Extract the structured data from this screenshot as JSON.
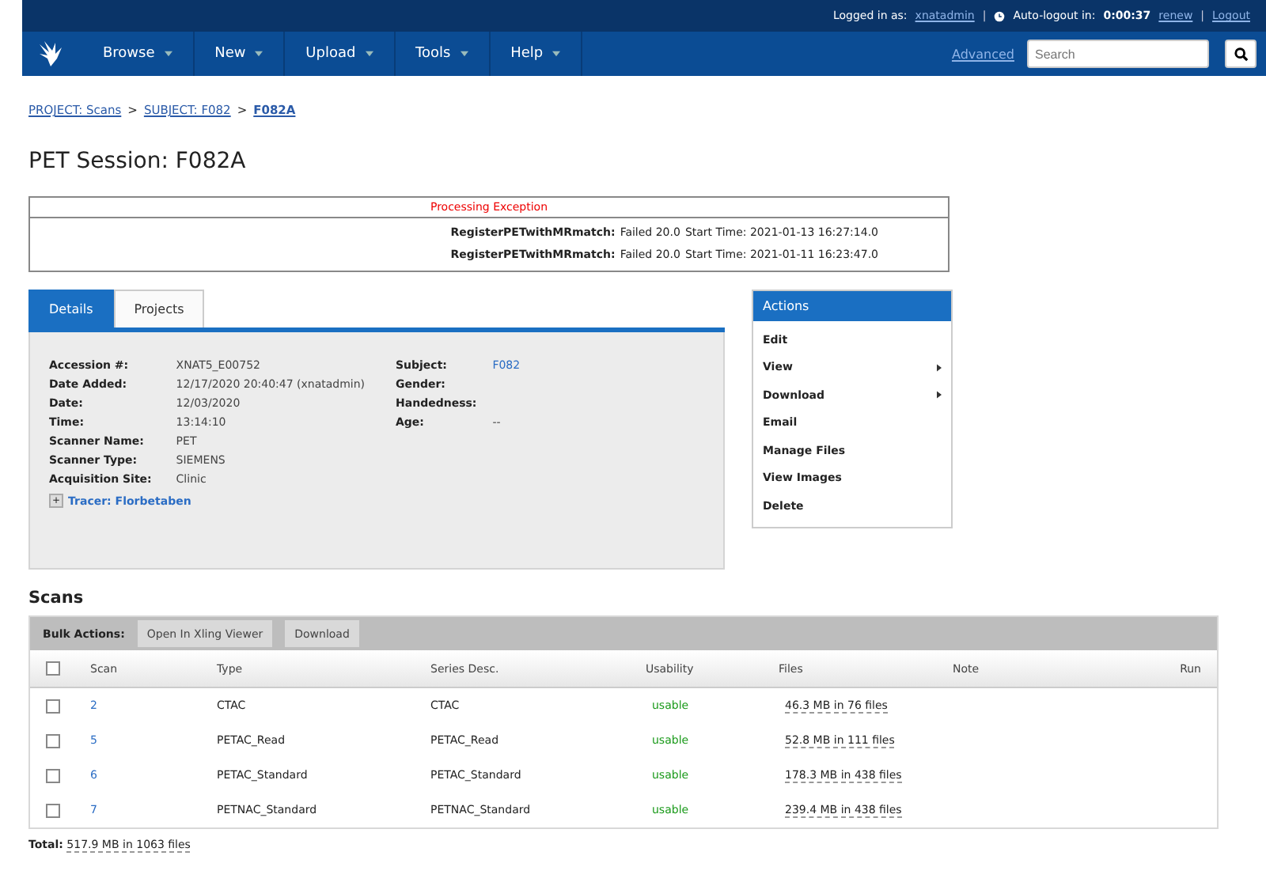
{
  "top_bar": {
    "logged_in_label": "Logged in as:",
    "username": "xnatadmin",
    "auto_logout_label": "Auto-logout in:",
    "timer": "0:00:37",
    "renew": "renew",
    "logout": "Logout",
    "separators": [
      "|",
      "|"
    ]
  },
  "nav": {
    "menus": [
      "Browse",
      "New",
      "Upload",
      "Tools",
      "Help"
    ],
    "advanced": "Advanced",
    "search": {
      "placeholder": "Search"
    }
  },
  "breadcrumb": [
    {
      "label": "PROJECT: Scans"
    },
    {
      "label": "SUBJECT: F082",
      "separator": ">"
    },
    {
      "label": "F082A",
      "separator": ">"
    }
  ],
  "title": "PET Session: F082A",
  "exceptions": {
    "title": "Processing Exception",
    "rows": [
      {
        "pipeline": "RegisterPETwithMRmatch:",
        "status": "Failed 20.0",
        "start": "Start Time: 2021-01-13 16:27:14.0"
      },
      {
        "pipeline": "RegisterPETwithMRmatch:",
        "status": "Failed 20.0",
        "start": "Start Time: 2021-01-11 16:23:47.0"
      }
    ]
  },
  "tabs": [
    {
      "label": "Details",
      "selected": true
    },
    {
      "label": "Projects",
      "selected": false
    }
  ],
  "details_left": [
    {
      "label": "Accession #:",
      "value": "XNAT5_E00752"
    },
    {
      "label": "Date Added:",
      "value": "12/17/2020 20:40:47 (xnatadmin)"
    },
    {
      "label": "Date:",
      "value": "12/03/2020"
    },
    {
      "label": "Time:",
      "value": "13:14:10"
    },
    {
      "label": "Scanner Name:",
      "value": "PET"
    },
    {
      "label": "Scanner Type:",
      "value": "SIEMENS"
    },
    {
      "label": "Acquisition Site:",
      "value": "Clinic"
    }
  ],
  "details_right": [
    {
      "label": "Subject:",
      "value": "F082",
      "kind": "link"
    },
    {
      "label": "Gender:",
      "kind": "text"
    },
    {
      "label": "Handedness:",
      "kind": "text"
    },
    {
      "label": "Age:",
      "value": "--",
      "kind": "text"
    }
  ],
  "tracer": {
    "toggle": "+",
    "label": "Tracer: Florbetaben",
    "expanded": false
  },
  "actions": {
    "title": "Actions",
    "items": [
      {
        "label": "Edit",
        "submenu": false
      },
      {
        "label": "View",
        "submenu": true
      },
      {
        "label": "Download",
        "submenu": true
      },
      {
        "label": "Email",
        "submenu": false
      },
      {
        "label": "Manage Files",
        "submenu": false
      },
      {
        "label": "View Images",
        "submenu": false
      },
      {
        "label": "Delete",
        "submenu": false
      }
    ]
  },
  "scans": {
    "heading": "Scans",
    "bulk_label": "Bulk Actions:",
    "bulk_buttons": [
      "Open In Xling Viewer",
      "Download"
    ],
    "select_all_checked": false,
    "columns": [
      "Scan",
      "Type",
      "Series Desc.",
      "Usability",
      "Files",
      "Note",
      "Run"
    ],
    "rows": [
      {
        "checked": false,
        "scan": "2",
        "type": "CTAC",
        "series": "CTAC",
        "usability": "usable",
        "files": "46.3 MB in 76 files"
      },
      {
        "checked": false,
        "scan": "5",
        "type": "PETAC_Read",
        "series": "PETAC_Read",
        "usability": "usable",
        "files": "52.8 MB in 111 files"
      },
      {
        "checked": false,
        "scan": "6",
        "type": "PETAC_Standard",
        "series": "PETAC_Standard",
        "usability": "usable",
        "files": "178.3 MB in 438 files"
      },
      {
        "checked": false,
        "scan": "7",
        "type": "PETNAC_Standard",
        "series": "PETNAC_Standard",
        "usability": "usable",
        "files": "239.4 MB in 438 files"
      }
    ],
    "total_label": "Total:",
    "total": "517.9 MB in 1063 files"
  }
}
